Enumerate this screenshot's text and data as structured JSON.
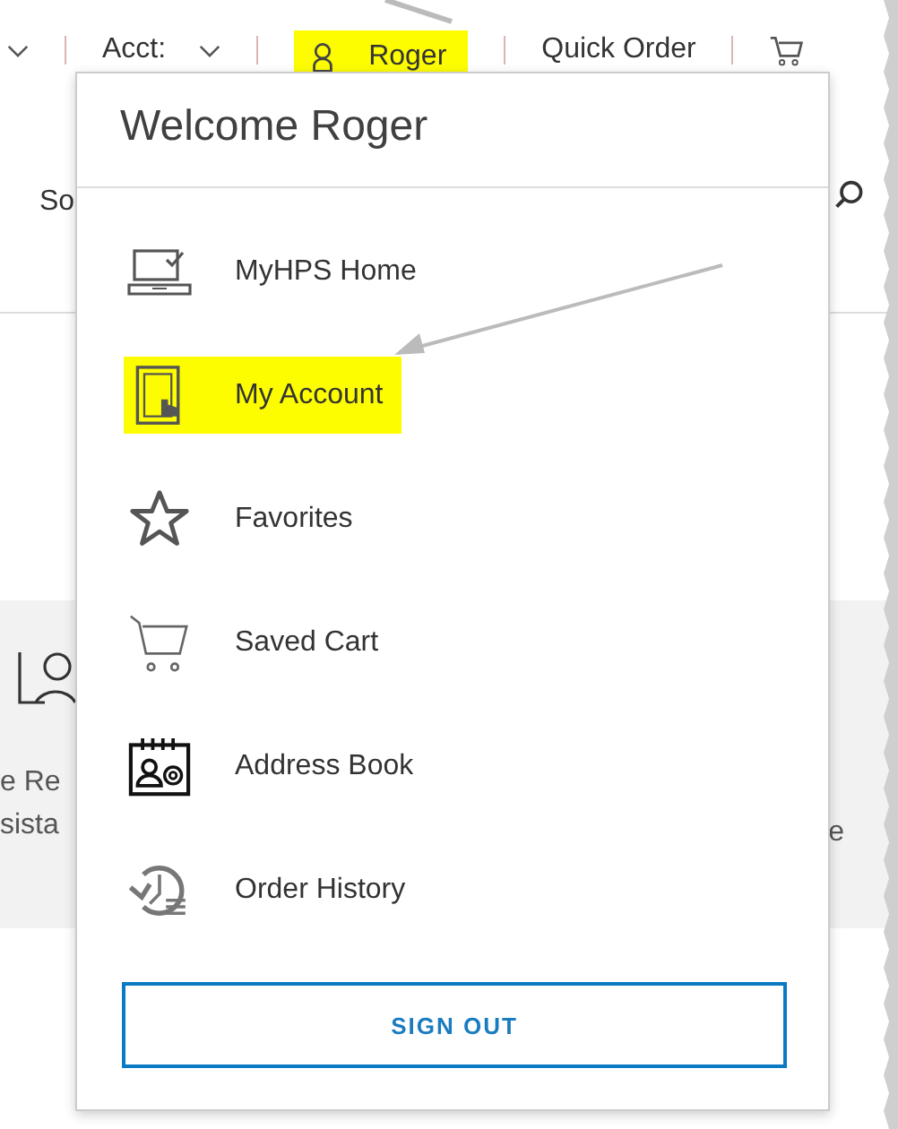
{
  "top_bar": {
    "account_label": "Acct:",
    "user": {
      "label": "Roger",
      "highlighted": true
    },
    "quick_order": "Quick Order"
  },
  "background": {
    "search_label": "So",
    "fragments_left": [
      "e Re",
      "sista"
    ],
    "fragment_right": "e"
  },
  "menu": {
    "title": "Welcome Roger",
    "items": [
      {
        "kind": "home",
        "label": "MyHPS Home",
        "highlighted": false
      },
      {
        "kind": "account",
        "label": "My Account",
        "highlighted": true
      },
      {
        "kind": "favorites",
        "label": "Favorites",
        "highlighted": false
      },
      {
        "kind": "cart",
        "label": "Saved Cart",
        "highlighted": false
      },
      {
        "kind": "address",
        "label": "Address Book",
        "highlighted": false
      },
      {
        "kind": "history",
        "label": "Order History",
        "highlighted": false
      }
    ],
    "sign_out": "SIGN OUT"
  }
}
